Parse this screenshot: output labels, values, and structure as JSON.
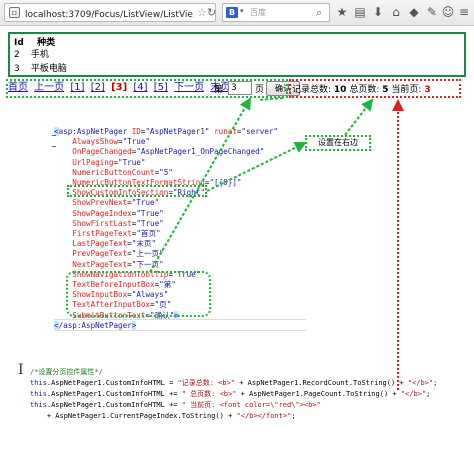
{
  "browser": {
    "url": "localhost:3709/Focus/ListView/ListView分页A",
    "search_placeholder": "百度",
    "search_logo": "B",
    "icons": [
      "page-icon",
      "star-icon",
      "refresh-icon",
      "search-icon",
      "bookmark-icon",
      "download-icon",
      "home-icon",
      "shield-icon",
      "plugin-icon",
      "smiley-icon",
      "menu-icon"
    ]
  },
  "list": {
    "header": {
      "id": "Id",
      "name": "种类"
    },
    "rows": [
      {
        "id": "2",
        "name": "手机"
      },
      {
        "id": "3",
        "name": "平板电脑"
      }
    ]
  },
  "pager": {
    "first": "首页",
    "prev": "上一页",
    "pages": [
      "[1]",
      "[2]",
      "[3]",
      "[4]",
      "[5]"
    ],
    "current_page": "[3]",
    "next": "下一页",
    "last": "末页",
    "input_prefix": "第",
    "input_value": "3",
    "input_suffix": "页",
    "submit": "确认",
    "info_records_label": "记录总数:",
    "info_records": "10",
    "info_pages_label": "总页数:",
    "info_pages": "5",
    "info_current_label": "当前页:",
    "info_current": "3",
    "info_current_color": "#d00000"
  },
  "annotation": {
    "note": "设置在右边"
  },
  "markup_code": [
    {
      "t": "<",
      "c": "tag",
      "hi": true
    },
    {
      "t": "asp",
      "c": "tag"
    }
  ],
  "code_lines": [
    "<asp:AspNetPager ID=\"AspNetPager1\" runat=\"server\"",
    "    AlwaysShow=\"True\"",
    "    OnPageChanged=\"AspNetPager1_OnPageChanged\"",
    "    UrlPaging=\"True\"",
    "    NumericButtonCount =\"5\"",
    "    NumericButtonTextFormatString=\"[{0}]\"",
    "    ShowCustomInfoSection=\"Right\"",
    "    ShowPrevNext=\"True\"",
    "    ShowPageIndex=\"True\"",
    "    ShowFirstLast=\"True\"",
    "    FirstPageText=\"首页\"",
    "    LastPageText=\"末页\"",
    "    PrevPageText=\"上一页\"",
    "    NextPageText=\"下一页\"",
    "    ShowNavigationToolTip=\"True\"",
    "    TextBeforeInputBox=\"第\"",
    "    ShowInputBox=\"Always\"",
    "    TextAfterInputBox=\"页\"",
    "    SubmitButtonText=\"确认\">",
    "</asp:AspNetPager>"
  ],
  "cs_code": {
    "comment": "/*设置分页控件属性*/",
    "line1": "this.AspNetPager1.CustomInfoHTML = \"记录总数: <b>\" + AspNetPager1.RecordCount.ToString() + \"</b>\";",
    "line2": "this.AspNetPager1.CustomInfoHTML += \" 总页数: <b>\" + AspNetPager1.PageCount.ToString() + \"</b>\";",
    "line3": "this.AspNetPager1.CustomInfoHTML += \" 当前页: <font color=\\\"red\\\"><b>\"",
    "line4": "    + AspNetPager1.CurrentPageIndex.ToString() + \"</b></font>\";"
  }
}
